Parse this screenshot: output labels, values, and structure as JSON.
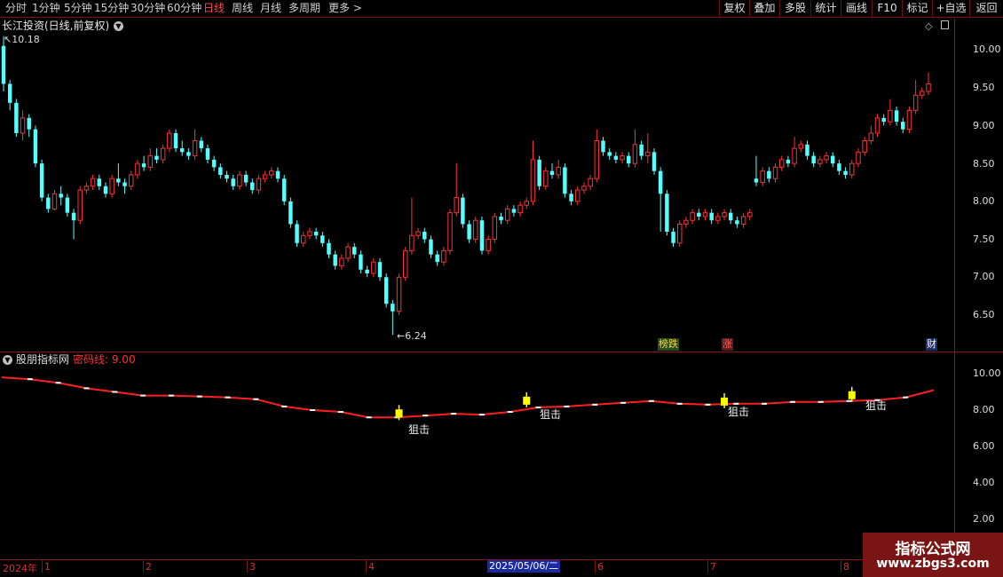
{
  "toolbar": {
    "timeframes": [
      "分时",
      "1分钟",
      "5分钟",
      "15分钟",
      "30分钟",
      "60分钟",
      "日线",
      "周线",
      "月线",
      "多周期",
      "更多 >"
    ],
    "active_timeframe": "日线",
    "right_buttons": [
      "复权",
      "叠加",
      "多股",
      "统计",
      "画线",
      "F10",
      "标记",
      "+自选",
      "返回"
    ]
  },
  "stock": {
    "title": "长江投资(日线,前复权)"
  },
  "price_axis": {
    "labels": [
      "10.00",
      "9.50",
      "9.00",
      "8.50",
      "8.00",
      "7.50",
      "7.00",
      "6.50"
    ]
  },
  "annotations": {
    "high": "10.18",
    "low": "6.24"
  },
  "badges": {
    "b1": "榜跌",
    "b2": "涨",
    "b3": "财"
  },
  "indicator": {
    "title": "股朋指标网",
    "line_label": "密码线: 9.00",
    "axis_labels": [
      "10.00",
      "8.00",
      "6.00",
      "4.00",
      "2.00"
    ],
    "signal_label": "狙击"
  },
  "date_axis": {
    "year": "2024年",
    "months": [
      "1",
      "2",
      "3",
      "4",
      "6",
      "7",
      "8"
    ],
    "cursor_date": "2025/05/06/二"
  },
  "watermark": {
    "line1": "指标公式网",
    "line2": "www.zbgs3.com"
  },
  "colors": {
    "up": "#ff3232",
    "down": "#54ffff",
    "axis": "#8a1515",
    "signal": "#ffff00"
  },
  "chart_data": {
    "type": "candlestick",
    "price_range": [
      6.24,
      10.18
    ],
    "indicator_range": [
      2,
      10
    ],
    "candles": [
      [
        10.05,
        9.55,
        10.18,
        9.45
      ],
      [
        9.55,
        9.3,
        9.6,
        9.2
      ],
      [
        9.3,
        8.9,
        9.35,
        8.85
      ],
      [
        8.9,
        9.1,
        9.2,
        8.8
      ],
      [
        9.1,
        8.95,
        9.15,
        8.85
      ],
      [
        8.95,
        8.5,
        9.0,
        8.45
      ],
      [
        8.5,
        8.05,
        8.55,
        8.0
      ],
      [
        8.05,
        7.9,
        8.1,
        7.85
      ],
      [
        7.9,
        8.1,
        8.15,
        7.88
      ],
      [
        8.1,
        8.05,
        8.2,
        7.95
      ],
      [
        8.05,
        7.85,
        8.1,
        7.8
      ],
      [
        7.85,
        7.75,
        7.9,
        7.5
      ],
      [
        7.75,
        8.15,
        8.2,
        7.7
      ],
      [
        8.15,
        8.2,
        8.25,
        8.1
      ],
      [
        8.2,
        8.3,
        8.35,
        8.15
      ],
      [
        8.3,
        8.2,
        8.35,
        8.15
      ],
      [
        8.2,
        8.1,
        8.25,
        8.05
      ],
      [
        8.1,
        8.3,
        8.35,
        8.05
      ],
      [
        8.3,
        8.25,
        8.5,
        8.2
      ],
      [
        8.25,
        8.2,
        8.3,
        8.1
      ],
      [
        8.2,
        8.35,
        8.4,
        8.15
      ],
      [
        8.35,
        8.5,
        8.55,
        8.3
      ],
      [
        8.5,
        8.45,
        8.6,
        8.4
      ],
      [
        8.45,
        8.6,
        8.7,
        8.4
      ],
      [
        8.6,
        8.55,
        8.7,
        8.5
      ],
      [
        8.55,
        8.7,
        8.75,
        8.5
      ],
      [
        8.7,
        8.9,
        8.95,
        8.65
      ],
      [
        8.9,
        8.7,
        8.95,
        8.65
      ],
      [
        8.7,
        8.65,
        8.8,
        8.6
      ],
      [
        8.65,
        8.6,
        8.7,
        8.55
      ],
      [
        8.6,
        8.8,
        8.95,
        8.55
      ],
      [
        8.8,
        8.7,
        8.85,
        8.65
      ],
      [
        8.7,
        8.55,
        8.75,
        8.5
      ],
      [
        8.55,
        8.45,
        8.6,
        8.4
      ],
      [
        8.45,
        8.35,
        8.5,
        8.3
      ],
      [
        8.35,
        8.3,
        8.4,
        8.25
      ],
      [
        8.3,
        8.2,
        8.35,
        8.15
      ],
      [
        8.2,
        8.35,
        8.4,
        8.15
      ],
      [
        8.35,
        8.25,
        8.4,
        8.2
      ],
      [
        8.25,
        8.15,
        8.3,
        8.1
      ],
      [
        8.15,
        8.3,
        8.35,
        8.1
      ],
      [
        8.3,
        8.35,
        8.4,
        8.25
      ],
      [
        8.35,
        8.4,
        8.45,
        8.3
      ],
      [
        8.4,
        8.3,
        8.45,
        8.25
      ],
      [
        8.3,
        8.0,
        8.35,
        7.95
      ],
      [
        8.0,
        7.7,
        8.05,
        7.65
      ],
      [
        7.7,
        7.45,
        7.75,
        7.4
      ],
      [
        7.45,
        7.55,
        7.6,
        7.4
      ],
      [
        7.55,
        7.6,
        7.65,
        7.5
      ],
      [
        7.6,
        7.55,
        7.65,
        7.5
      ],
      [
        7.55,
        7.45,
        7.6,
        7.4
      ],
      [
        7.45,
        7.3,
        7.5,
        7.25
      ],
      [
        7.3,
        7.15,
        7.35,
        7.1
      ],
      [
        7.15,
        7.25,
        7.3,
        7.1
      ],
      [
        7.25,
        7.4,
        7.45,
        7.2
      ],
      [
        7.4,
        7.3,
        7.45,
        7.25
      ],
      [
        7.3,
        7.1,
        7.35,
        7.05
      ],
      [
        7.1,
        7.05,
        7.15,
        7.0
      ],
      [
        7.05,
        7.2,
        7.25,
        7.0
      ],
      [
        7.2,
        7.0,
        7.25,
        6.95
      ],
      [
        7.0,
        6.65,
        7.05,
        6.6
      ],
      [
        6.65,
        6.55,
        6.7,
        6.24
      ],
      [
        6.55,
        7.0,
        7.05,
        6.5
      ],
      [
        7.0,
        7.35,
        7.4,
        6.95
      ],
      [
        7.35,
        7.55,
        8.05,
        7.3
      ],
      [
        7.55,
        7.6,
        7.65,
        7.5
      ],
      [
        7.6,
        7.5,
        7.65,
        7.45
      ],
      [
        7.5,
        7.3,
        7.55,
        7.25
      ],
      [
        7.3,
        7.2,
        7.35,
        7.15
      ],
      [
        7.2,
        7.35,
        7.4,
        7.15
      ],
      [
        7.35,
        7.85,
        7.9,
        7.3
      ],
      [
        7.85,
        8.05,
        8.5,
        7.8
      ],
      [
        8.05,
        7.7,
        8.1,
        7.65
      ],
      [
        7.7,
        7.5,
        7.75,
        7.45
      ],
      [
        7.5,
        7.75,
        7.8,
        7.45
      ],
      [
        7.75,
        7.35,
        7.8,
        7.3
      ],
      [
        7.35,
        7.5,
        7.55,
        7.3
      ],
      [
        7.5,
        7.8,
        7.85,
        7.45
      ],
      [
        7.8,
        7.75,
        7.85,
        7.7
      ],
      [
        7.75,
        7.9,
        7.95,
        7.7
      ],
      [
        7.9,
        7.85,
        7.95,
        7.8
      ],
      [
        7.85,
        7.95,
        8.0,
        7.8
      ],
      [
        7.95,
        8.0,
        8.05,
        7.9
      ],
      [
        8.0,
        8.55,
        8.8,
        7.95
      ],
      [
        8.55,
        8.2,
        8.6,
        8.15
      ],
      [
        8.2,
        8.4,
        8.45,
        8.15
      ],
      [
        8.4,
        8.35,
        8.5,
        8.3
      ],
      [
        8.35,
        8.45,
        8.55,
        8.3
      ],
      [
        8.45,
        8.1,
        8.5,
        8.05
      ],
      [
        8.1,
        8.0,
        8.15,
        7.95
      ],
      [
        8.0,
        8.15,
        8.2,
        7.95
      ],
      [
        8.15,
        8.2,
        8.25,
        8.1
      ],
      [
        8.2,
        8.3,
        8.35,
        8.15
      ],
      [
        8.3,
        8.8,
        8.95,
        8.25
      ],
      [
        8.8,
        8.65,
        8.85,
        8.6
      ],
      [
        8.65,
        8.6,
        8.7,
        8.55
      ],
      [
        8.6,
        8.55,
        8.65,
        8.5
      ],
      [
        8.55,
        8.6,
        8.65,
        8.5
      ],
      [
        8.6,
        8.5,
        8.65,
        8.45
      ],
      [
        8.5,
        8.75,
        8.95,
        8.45
      ],
      [
        8.75,
        8.6,
        8.8,
        8.55
      ],
      [
        8.6,
        8.65,
        8.9,
        8.5
      ],
      [
        8.65,
        8.4,
        8.7,
        8.35
      ],
      [
        8.4,
        8.1,
        8.45,
        7.6
      ],
      [
        8.1,
        7.6,
        8.15,
        7.55
      ],
      [
        7.6,
        7.45,
        7.65,
        7.4
      ],
      [
        7.45,
        7.7,
        7.75,
        7.4
      ],
      [
        7.7,
        7.75,
        7.8,
        7.65
      ],
      [
        7.75,
        7.85,
        7.9,
        7.7
      ],
      [
        7.85,
        7.8,
        7.9,
        7.75
      ],
      [
        7.8,
        7.85,
        7.9,
        7.75
      ],
      [
        7.85,
        7.75,
        7.9,
        7.7
      ],
      [
        7.75,
        7.8,
        7.85,
        7.7
      ],
      [
        7.8,
        7.85,
        7.9,
        7.75
      ],
      [
        7.85,
        7.75,
        7.9,
        7.7
      ],
      [
        7.75,
        7.7,
        7.8,
        7.65
      ],
      [
        7.7,
        7.8,
        7.85,
        7.65
      ],
      [
        7.8,
        7.85,
        7.9,
        7.75
      ],
      [
        8.3,
        8.25,
        8.6,
        8.2
      ],
      [
        8.25,
        8.4,
        8.45,
        8.2
      ],
      [
        8.4,
        8.3,
        8.45,
        8.25
      ],
      [
        8.3,
        8.45,
        8.5,
        8.25
      ],
      [
        8.45,
        8.55,
        8.6,
        8.4
      ],
      [
        8.55,
        8.5,
        8.6,
        8.45
      ],
      [
        8.5,
        8.7,
        8.85,
        8.45
      ],
      [
        8.7,
        8.75,
        8.8,
        8.65
      ],
      [
        8.75,
        8.6,
        8.8,
        8.55
      ],
      [
        8.6,
        8.5,
        8.65,
        8.45
      ],
      [
        8.5,
        8.55,
        8.6,
        8.45
      ],
      [
        8.55,
        8.6,
        8.65,
        8.5
      ],
      [
        8.6,
        8.5,
        8.65,
        8.45
      ],
      [
        8.5,
        8.4,
        8.55,
        8.35
      ],
      [
        8.4,
        8.35,
        8.45,
        8.3
      ],
      [
        8.35,
        8.5,
        8.55,
        8.3
      ],
      [
        8.5,
        8.65,
        8.7,
        8.45
      ],
      [
        8.65,
        8.8,
        8.85,
        8.6
      ],
      [
        8.8,
        8.9,
        9.0,
        8.75
      ],
      [
        8.9,
        9.1,
        9.15,
        8.85
      ],
      [
        9.1,
        9.05,
        9.15,
        9.0
      ],
      [
        9.05,
        9.2,
        9.35,
        9.0
      ],
      [
        9.2,
        9.05,
        9.25,
        9.0
      ],
      [
        9.05,
        8.95,
        9.1,
        8.9
      ],
      [
        8.95,
        9.2,
        9.25,
        8.9
      ],
      [
        9.2,
        9.4,
        9.6,
        9.15
      ],
      [
        9.4,
        9.45,
        9.5,
        9.35
      ],
      [
        9.45,
        9.55,
        9.7,
        9.4
      ]
    ],
    "mima_line": [
      9.8,
      9.7,
      9.5,
      9.2,
      9.0,
      8.8,
      8.8,
      8.75,
      8.7,
      8.6,
      8.2,
      8.0,
      7.9,
      7.6,
      7.6,
      7.7,
      7.8,
      7.75,
      7.9,
      8.15,
      8.2,
      8.3,
      8.4,
      8.5,
      8.35,
      8.3,
      8.35,
      8.35,
      8.45,
      8.45,
      8.5,
      8.55,
      8.7,
      9.1
    ],
    "signals": [
      {
        "x_index": 62,
        "value": 7.6
      },
      {
        "x_index": 82,
        "value": 8.3
      },
      {
        "x_index": 113,
        "value": 8.25
      },
      {
        "x_index": 133,
        "value": 8.6
      }
    ]
  }
}
